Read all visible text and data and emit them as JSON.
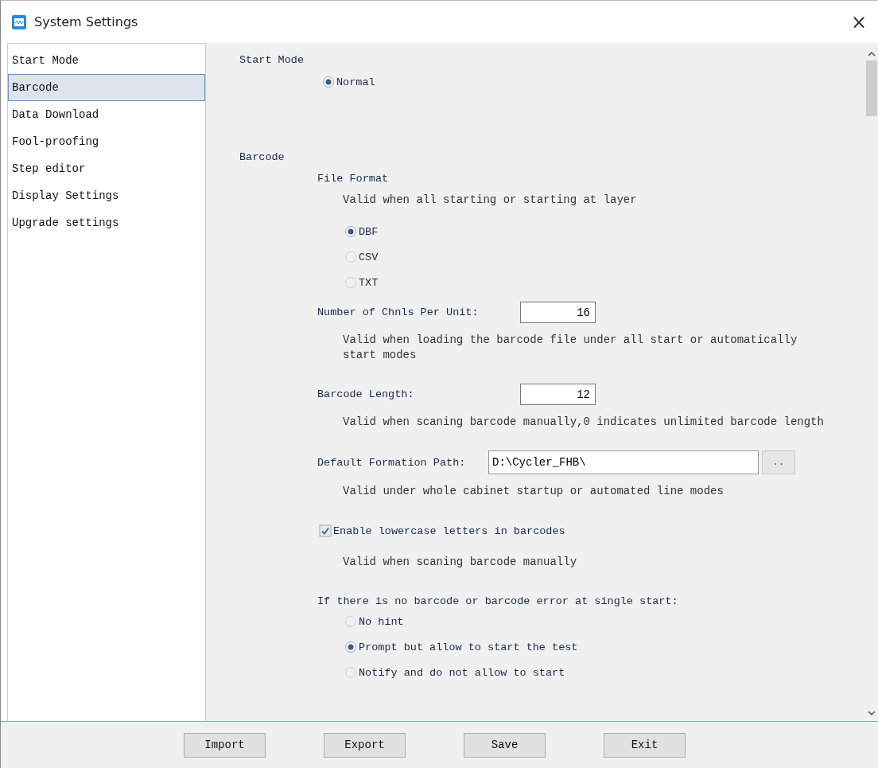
{
  "window": {
    "title": "System Settings",
    "close": "×"
  },
  "sidebar": {
    "items": [
      {
        "label": "Start Mode",
        "selected": false
      },
      {
        "label": "Barcode",
        "selected": true
      },
      {
        "label": "Data Download",
        "selected": false
      },
      {
        "label": "Fool-proofing",
        "selected": false
      },
      {
        "label": "Step editor",
        "selected": false
      },
      {
        "label": "Display Settings",
        "selected": false
      },
      {
        "label": "Upgrade settings",
        "selected": false
      }
    ]
  },
  "sections": [
    {
      "title": "Start Mode",
      "items": [
        {
          "kind": "radio",
          "label": "Normal",
          "selected": true
        }
      ]
    },
    {
      "title": "Barcode",
      "items": [
        {
          "kind": "subheading",
          "text": "File Format"
        },
        {
          "kind": "hint",
          "text": "Valid when all starting or starting at layer"
        },
        {
          "kind": "radio",
          "label": "DBF",
          "selected": true
        },
        {
          "kind": "radio",
          "label": "CSV",
          "selected": false
        },
        {
          "kind": "radio",
          "label": "TXT",
          "selected": false
        },
        {
          "kind": "number",
          "label": "Number of Chnls Per Unit:",
          "value": "16"
        },
        {
          "kind": "hint",
          "text": "Valid when loading the barcode file under all start or automatically start modes"
        },
        {
          "kind": "number",
          "label": "Barcode Length:",
          "value": "12"
        },
        {
          "kind": "hint",
          "text": "Valid when scaning barcode manually,0 indicates unlimited barcode length"
        },
        {
          "kind": "path",
          "label": "Default Formation Path:",
          "value": "D:\\Cycler_FHB\\",
          "button": ".."
        },
        {
          "kind": "hint",
          "text": "Valid under whole cabinet startup or  automated line modes"
        },
        {
          "kind": "checkbox",
          "label": "Enable lowercase letters in barcodes",
          "checked": true
        },
        {
          "kind": "hint",
          "text": "Valid when scaning barcode manually"
        },
        {
          "kind": "subheading",
          "text": "If there is no barcode or barcode error at single start:"
        },
        {
          "kind": "radio",
          "label": "No hint",
          "selected": false
        },
        {
          "kind": "radio",
          "label": "Prompt but allow to start the test",
          "selected": true
        },
        {
          "kind": "radio",
          "label": "Notify and do not allow to start",
          "selected": false
        }
      ]
    }
  ],
  "buttons": [
    "Import",
    "Export",
    "Save",
    "Exit"
  ]
}
